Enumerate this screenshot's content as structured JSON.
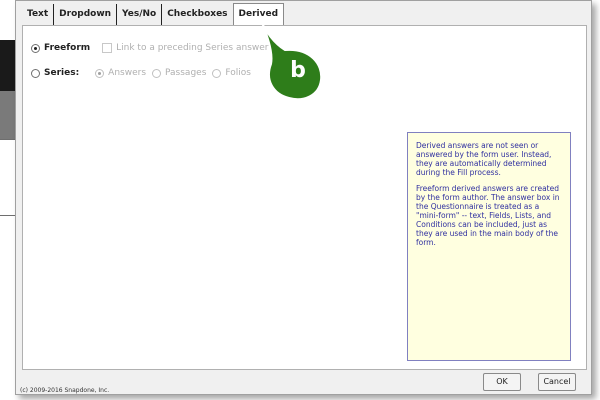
{
  "tabs": [
    {
      "label": "Text",
      "active": false
    },
    {
      "label": "Dropdown",
      "active": false
    },
    {
      "label": "Yes/No",
      "active": false
    },
    {
      "label": "Checkboxes",
      "active": false
    },
    {
      "label": "Derived",
      "active": true
    }
  ],
  "freeform": {
    "label": "Freeform",
    "selected": true,
    "link_checkbox_label": "Link to a preceding Series answer o"
  },
  "series": {
    "label": "Series:",
    "selected": false,
    "options": [
      {
        "label": "Answers",
        "selected": true
      },
      {
        "label": "Passages",
        "selected": false
      },
      {
        "label": "Folios",
        "selected": false
      }
    ]
  },
  "callout": {
    "label": "b",
    "color": "#2e7d1a"
  },
  "help": {
    "paragraph1": "Derived answers are not seen or answered by the form user.  Instead, they are automatically determined during the Fill process.",
    "paragraph2": "Freeform derived answers are created by the form author.  The answer box in the Questionnaire is treated as a \"mini-form\" -- text, Fields, Lists, and Conditions can be included, just as they are used in the main body of the form."
  },
  "footer": {
    "copyright": "(c) 2009-2016 Snapdone, Inc.",
    "ok_label": "OK",
    "cancel_label": "Cancel"
  }
}
